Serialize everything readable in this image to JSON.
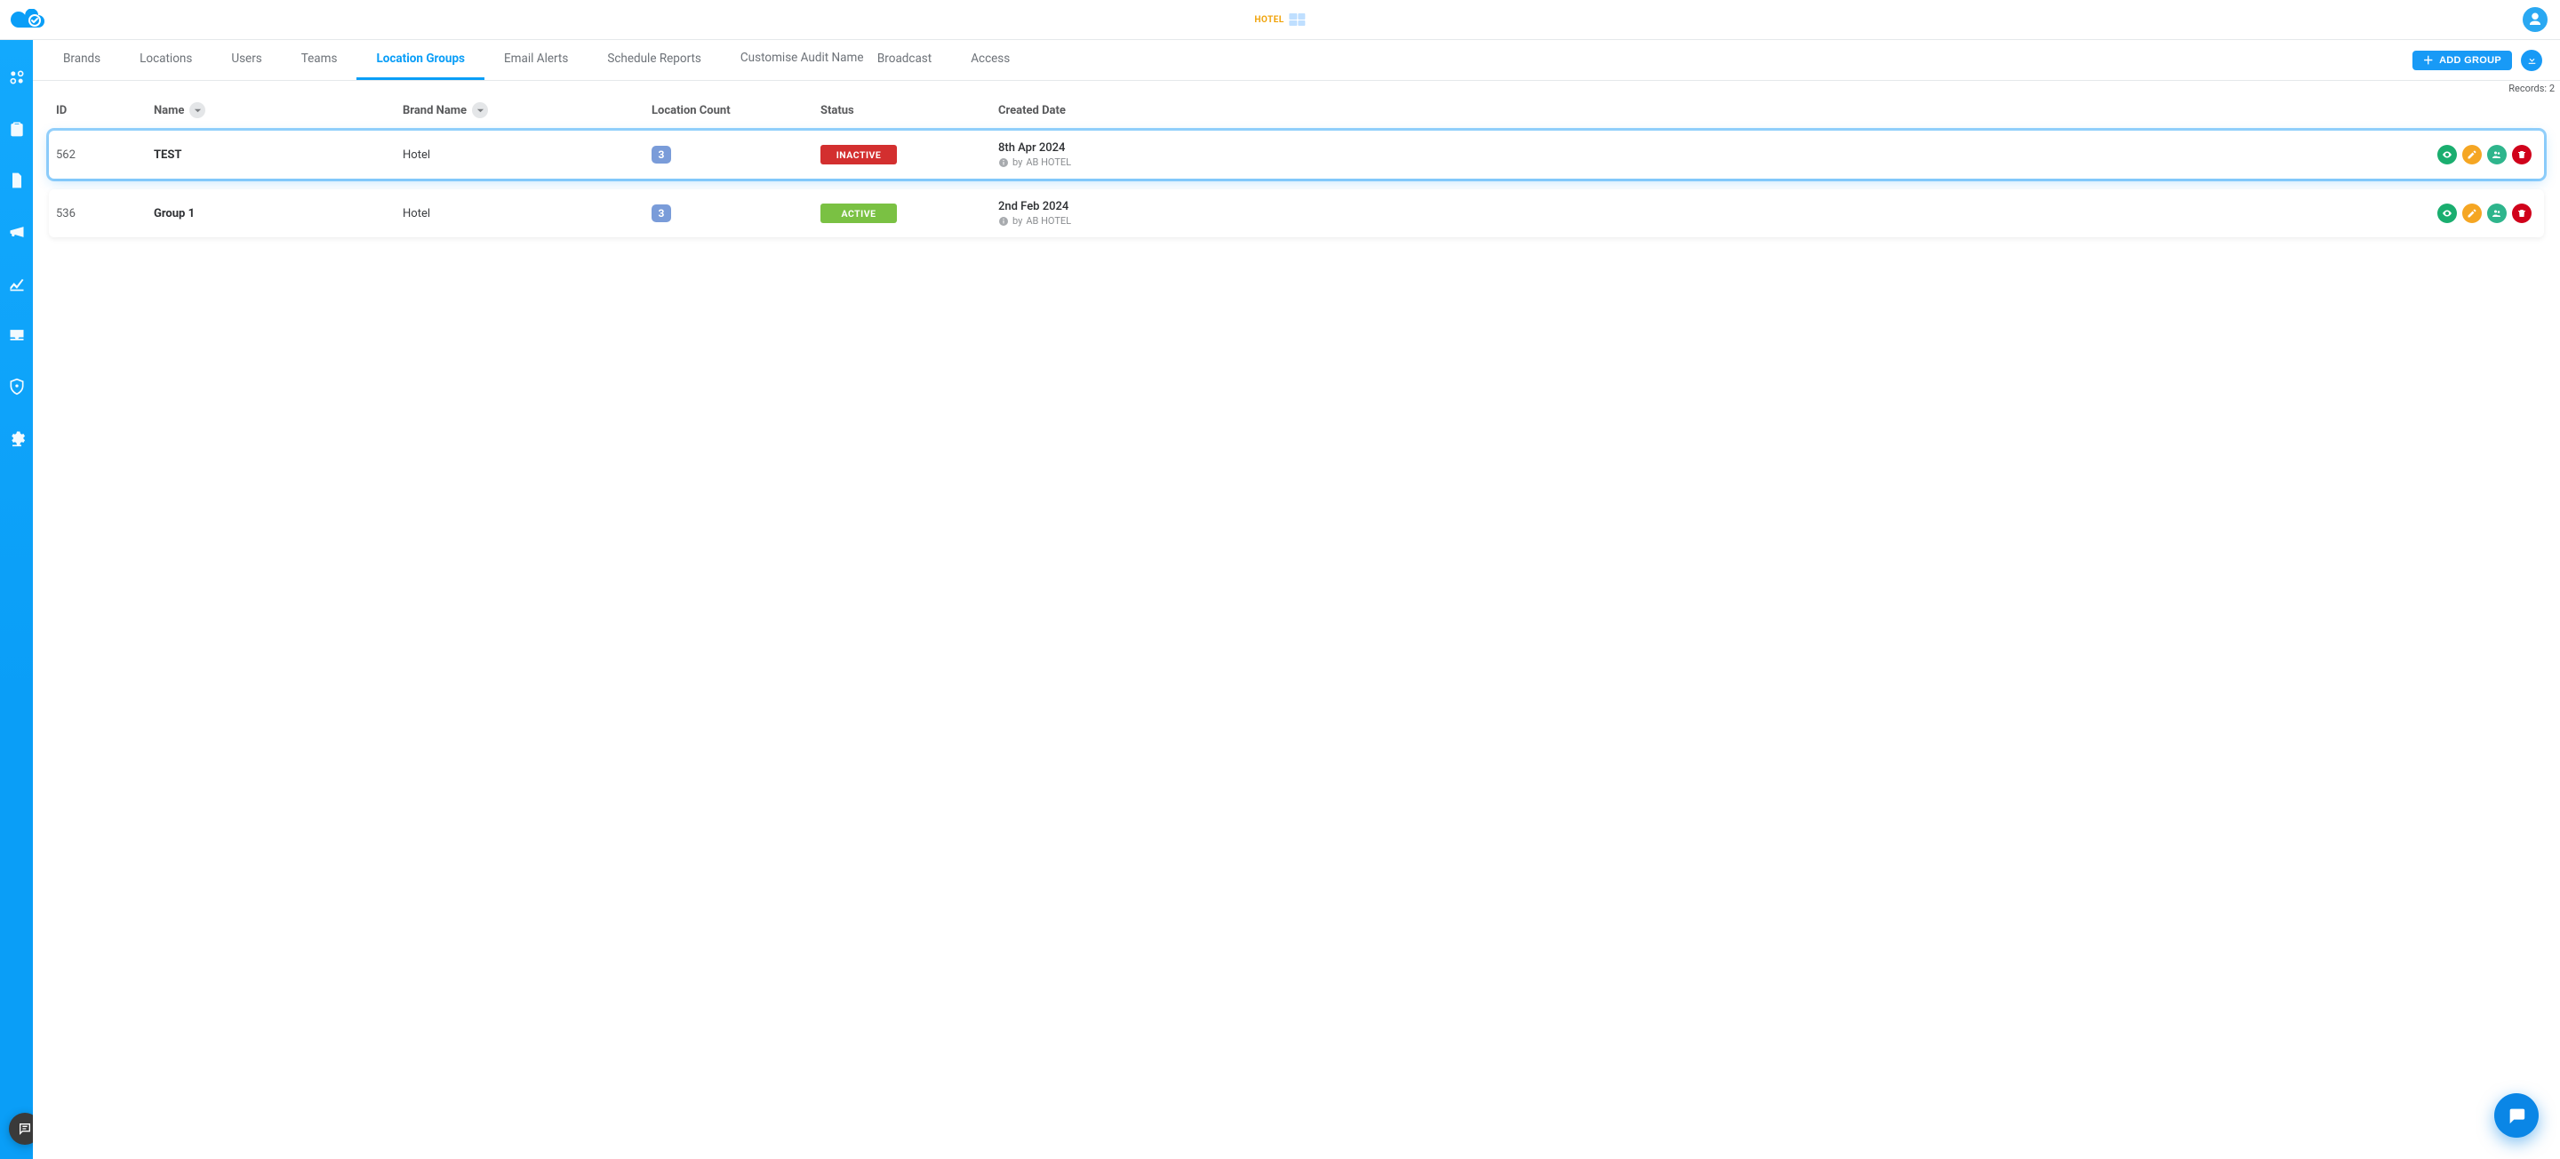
{
  "header": {
    "brand_title": "HOTEL"
  },
  "tabs": [
    {
      "label": "Brands",
      "active": false
    },
    {
      "label": "Locations",
      "active": false
    },
    {
      "label": "Users",
      "active": false
    },
    {
      "label": "Teams",
      "active": false
    },
    {
      "label": "Location Groups",
      "active": true
    },
    {
      "label": "Email Alerts",
      "active": false
    },
    {
      "label": "Schedule Reports",
      "active": false
    },
    {
      "label": "Customise Audit Name",
      "active": false,
      "two_line": true
    },
    {
      "label": "Broadcast",
      "active": false
    },
    {
      "label": "Access",
      "active": false
    }
  ],
  "toolbar": {
    "add_group_label": "ADD GROUP",
    "records_label": "Records:",
    "records_count": "2"
  },
  "columns": {
    "c0": "ID",
    "c1": "Name",
    "c2": "Brand Name",
    "c3": "Location Count",
    "c4": "Status",
    "c5": "Created Date"
  },
  "rows": [
    {
      "id": "562",
      "name": "TEST",
      "brand": "Hotel",
      "location_count": "3",
      "status": "INACTIVE",
      "status_class": "inactive",
      "created_date": "8th Apr 2024",
      "created_by_prefix": "by",
      "created_by": "AB HOTEL",
      "highlighted": true
    },
    {
      "id": "536",
      "name": "Group 1",
      "brand": "Hotel",
      "location_count": "3",
      "status": "ACTIVE",
      "status_class": "active",
      "created_date": "2nd Feb 2024",
      "created_by_prefix": "by",
      "created_by": "AB HOTEL",
      "highlighted": false
    }
  ],
  "sidebar_items": [
    {
      "icon": "dashboard-icon",
      "name": "sidebar-dashboard"
    },
    {
      "icon": "clipboard-icon",
      "name": "sidebar-audits"
    },
    {
      "icon": "document-icon",
      "name": "sidebar-reports"
    },
    {
      "icon": "megaphone-icon",
      "name": "sidebar-broadcast"
    },
    {
      "icon": "analytics-icon",
      "name": "sidebar-analytics"
    },
    {
      "icon": "inbox-icon",
      "name": "sidebar-inbox"
    },
    {
      "icon": "shield-icon",
      "name": "sidebar-security"
    },
    {
      "icon": "gear-icon",
      "name": "sidebar-settings"
    }
  ]
}
